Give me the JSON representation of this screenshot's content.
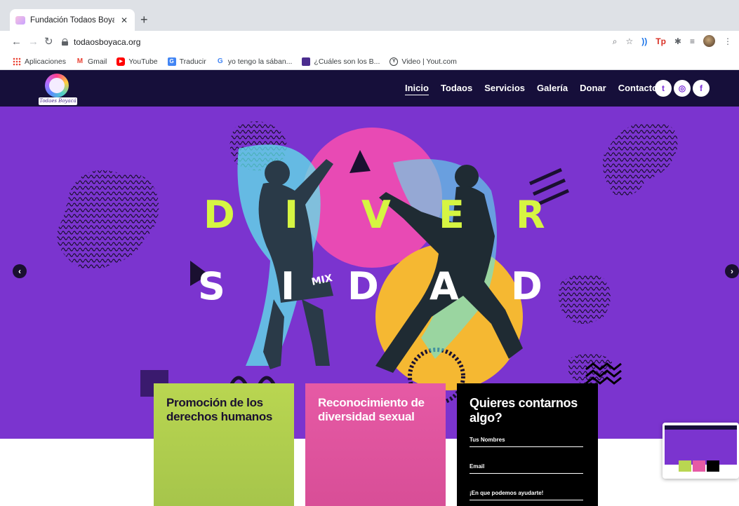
{
  "browser": {
    "tab_title": "Fundación Todaos Boyaca | Fu",
    "tab_close": "✕",
    "new_tab": "+",
    "url": "todaosboyaca.org",
    "bookmarks": [
      {
        "label": "Aplicaciones",
        "icon": "apps-grid-icon"
      },
      {
        "label": "Gmail",
        "icon": "gmail-icon"
      },
      {
        "label": "YouTube",
        "icon": "youtube-icon"
      },
      {
        "label": "Traducir",
        "icon": "translate-icon"
      },
      {
        "label": "yo tengo la sában...",
        "icon": "google-icon"
      },
      {
        "label": "¿Cuáles son los B...",
        "icon": "page-icon"
      },
      {
        "label": "Video | Yout.com",
        "icon": "yout-icon"
      }
    ]
  },
  "site": {
    "logo_text": "Todaes Boyacá",
    "menu": [
      "Inicio",
      "Todaos",
      "Servicios",
      "Galería",
      "Donar",
      "Contacto"
    ],
    "active_menu": "Inicio",
    "social": [
      "twitter-icon",
      "instagram-icon",
      "facebook-icon"
    ],
    "social_glyphs": {
      "twitter": "t",
      "instagram": "◎",
      "facebook": "f"
    },
    "hero_word_top": [
      "D",
      "I",
      "V",
      "E",
      "R"
    ],
    "hero_word_bottom": [
      "S",
      "I",
      "D",
      "A",
      "D"
    ],
    "shirt_text": "MIX",
    "colors": {
      "nav_bg": "#160f3a",
      "hero_bg": "#7b34cf",
      "accent_green": "#d6f542",
      "accent_pink": "#e65aa5",
      "accent_yellow": "#f5b832"
    }
  },
  "cards": [
    {
      "title_line1": "Promoción de los",
      "title_line2": "derechos humanos"
    },
    {
      "title_line1": "Reconocimiento de",
      "title_line2": "diversidad sexual"
    },
    {
      "title_line1": "Quieres contarnos",
      "title_line2": "algo?"
    }
  ],
  "form": {
    "name_label": "Tus Nombres",
    "email_label": "Email",
    "message_label": "¡En que podemos ayudarte!"
  }
}
